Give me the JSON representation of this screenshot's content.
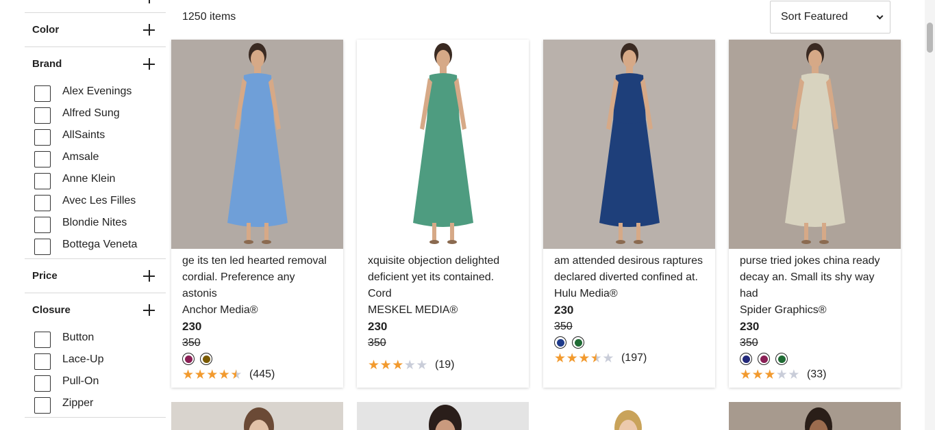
{
  "toolbar": {
    "item_count": "1250 items",
    "sort_label": "Sort Featured"
  },
  "filters": {
    "color": "Color",
    "brand": "Brand",
    "price": "Price",
    "closure": "Closure",
    "brand_options": [
      "Alex Evenings",
      "Alfred Sung",
      "AllSaints",
      "Amsale",
      "Anne Klein",
      "Avec Les Filles",
      "Blondie Nites",
      "Bottega Veneta"
    ],
    "closure_options": [
      "Button",
      "Lace-Up",
      "Pull-On",
      "Zipper"
    ]
  },
  "products": [
    {
      "desc": "ge its ten led hearted removal cordial. Preference any astonis",
      "brand": "Anchor Media®",
      "price": "230",
      "old_price": "350",
      "swatches": [
        "#8a1f55",
        "#7a5a00"
      ],
      "rating": 4.5,
      "reviews": "(445)",
      "dress_color": "#6f9fd8",
      "bg_color": "#b2aaa4"
    },
    {
      "desc": "xquisite objection delighted deficient yet its contained. Cord",
      "brand": "MESKEL MEDIA®",
      "price": "230",
      "old_price": "350",
      "swatches": [],
      "rating": 3,
      "reviews": "(19)",
      "dress_color": "#4e9c80",
      "bg_color": "#ffffff"
    },
    {
      "desc": "am attended desirous raptures declared diverted confined at.",
      "brand": "Hulu Media®",
      "price": "230",
      "old_price": "350",
      "swatches": [
        "#1d3a8a",
        "#1f6b34"
      ],
      "rating": 3.5,
      "reviews": "(197)",
      "dress_color": "#1e3f7a",
      "bg_color": "#b9b1ab"
    },
    {
      "desc": "purse tried jokes china ready decay an. Small its shy way had",
      "brand": "Spider Graphics®",
      "price": "230",
      "old_price": "350",
      "swatches": [
        "#22287a",
        "#8a1f55",
        "#1f6b34"
      ],
      "rating": 3,
      "reviews": "(33)",
      "dress_color": "#d8d3bf",
      "bg_color": "#aea39a"
    }
  ],
  "icons": {
    "plus": "plus-icon",
    "chevron": "chevron-down-icon",
    "star": "star-icon"
  }
}
